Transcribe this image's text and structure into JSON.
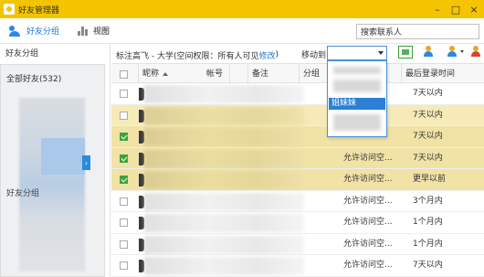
{
  "window": {
    "title": "好友管理器",
    "controls": [
      "minimize",
      "maximize",
      "close"
    ]
  },
  "toolbar": {
    "tabs": [
      {
        "label": "好友分组",
        "icon": "friends-icon",
        "active": true
      },
      {
        "label": "视图",
        "icon": "chart-icon",
        "active": false
      }
    ],
    "search_placeholder": "搜索联系人"
  },
  "sidebar": {
    "header": "好友分组",
    "all_friends": "全部好友(532)",
    "group_label": "好友分组",
    "collapse_glyph": "›"
  },
  "main": {
    "info_prefix": "标注高飞 - 大学(空间权限：所有人可见",
    "info_link": "修改",
    "info_suffix": ")",
    "move_label": "移动到",
    "toolbar_icons": [
      "export-excel-icon",
      "add-friend-icon",
      "manage-friend-icon",
      "delete-friend-icon"
    ]
  },
  "table": {
    "columns": {
      "name": "昵称",
      "account": "帐号",
      "remark": "备注",
      "group": "分组",
      "permission": "空间权限",
      "last_login": "最后登录时间"
    },
    "rows": [
      {
        "checked": false,
        "selected": false,
        "permission": "",
        "last_login": "7天以内"
      },
      {
        "checked": false,
        "selected": "light",
        "permission": "",
        "last_login": "7天以内"
      },
      {
        "checked": true,
        "selected": "dark",
        "permission": "",
        "last_login": "7天以内"
      },
      {
        "checked": true,
        "selected": "dark",
        "permission": "允许访问空...",
        "last_login": "7天以内"
      },
      {
        "checked": true,
        "selected": "dark",
        "permission": "允许访问空...",
        "last_login": "更早以前"
      },
      {
        "checked": false,
        "selected": false,
        "permission": "允许访问空...",
        "last_login": "3个月内"
      },
      {
        "checked": false,
        "selected": false,
        "permission": "允许访问空...",
        "last_login": "1个月内"
      },
      {
        "checked": false,
        "selected": false,
        "permission": "允许访问空...",
        "last_login": "1个月内"
      },
      {
        "checked": false,
        "selected": false,
        "permission": "允许访问空...",
        "last_login": "7天以内"
      }
    ]
  },
  "dropdown": {
    "selected_item": "姐妹妹"
  },
  "colors": {
    "titlebar": "#f5c400",
    "accent": "#1a7ad6",
    "selected_row": "#f1e2a6",
    "checkbox": "#3ea23e"
  }
}
